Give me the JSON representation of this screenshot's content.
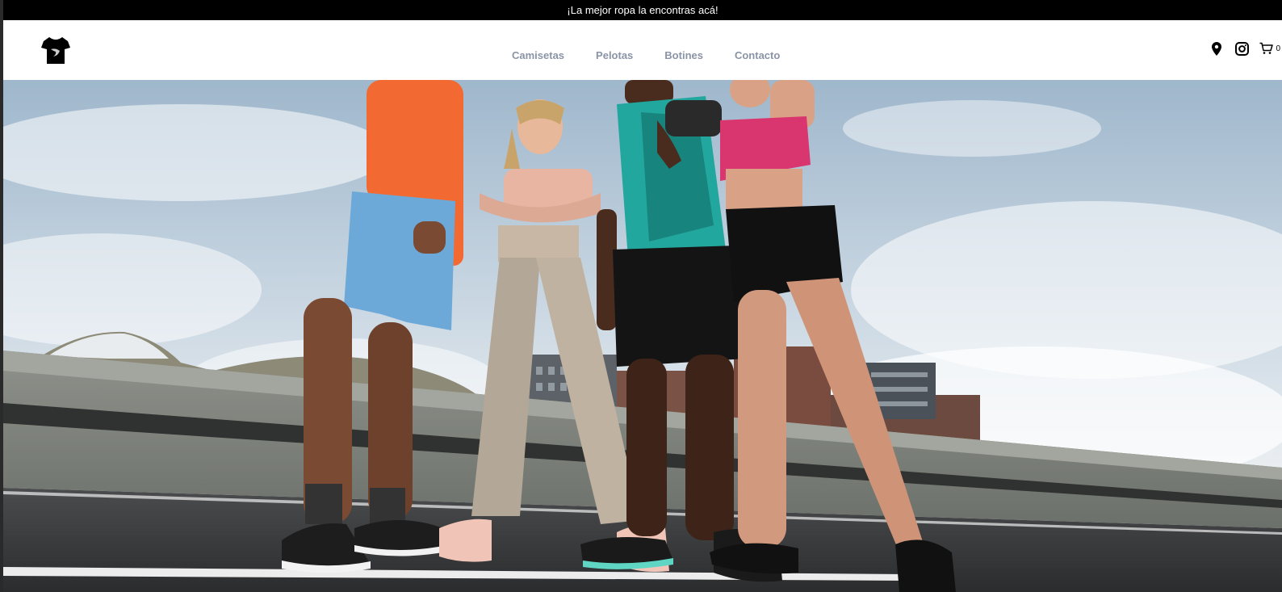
{
  "announcement": {
    "text": "¡La mejor ropa la encontras acá!"
  },
  "header": {
    "logo_icon": "tshirt-logo-icon",
    "nav": [
      {
        "label": "Camisetas"
      },
      {
        "label": "Pelotas"
      },
      {
        "label": "Botines"
      },
      {
        "label": "Contacto"
      }
    ],
    "icons": {
      "location": "map-pin-icon",
      "instagram": "instagram-icon",
      "cart": "shopping-cart-icon"
    },
    "cart_count": "0"
  },
  "hero": {
    "image_subject": "Four athletes in sportswear standing on a rooftop road under a cloudy sky"
  },
  "colors": {
    "announcement_bg": "#000000",
    "nav_text": "#8a94a6",
    "header_bg": "#ffffff"
  }
}
